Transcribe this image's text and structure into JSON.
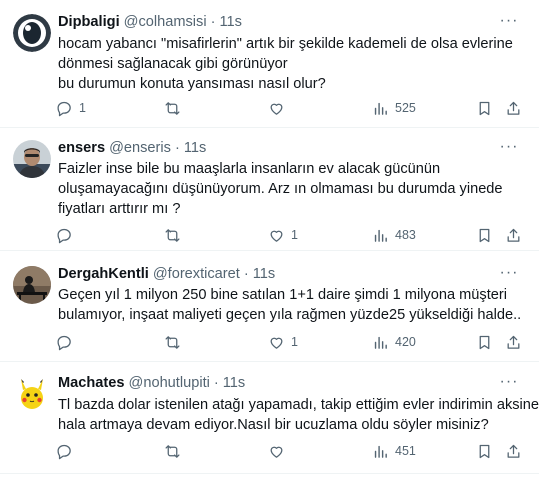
{
  "tweets": [
    {
      "name": "Dipbaligi",
      "handle": "@colhamsisi",
      "time": "11s",
      "lines": [
        "hocam yabancı \"misafirlerin\" artık bir şekilde kademeli de olsa evlerine",
        "dönmesi sağlanacak gibi görünüyor",
        "bu durumun konuta yansıması nasıl olur?"
      ],
      "replies": "1",
      "retweets": "",
      "likes": "",
      "views": "525",
      "avatar": "eye-logo-avatar"
    },
    {
      "name": "ensers",
      "handle": "@enseris",
      "time": "11s",
      "lines": [
        "Faizler inse bile bu maaşlarla insanların ev alacak gücünün",
        "oluşamayacağını düşünüyorum. Arz ın olmaması bu durumda yinede",
        "fiyatları arttırır mı ?"
      ],
      "replies": "",
      "retweets": "",
      "likes": "1",
      "views": "483",
      "avatar": "person-photo-avatar"
    },
    {
      "name": "DergahKentli",
      "handle": "@forexticaret",
      "time": "11s",
      "lines": [
        "Geçen yıl 1 milyon 250 bine satılan 1+1 daire şimdi 1 milyona müşteri",
        "bulamıyor, inşaat maliyeti geçen yıla rağmen yüzde25 yükseldiği halde.."
      ],
      "replies": "",
      "retweets": "",
      "likes": "1",
      "views": "420",
      "avatar": "silhouette-bench-avatar"
    },
    {
      "name": "Machates",
      "handle": "@nohutlupiti",
      "time": "11s",
      "lines": [
        "Tl bazda dolar istenilen atağı yapamadı, takip ettiğim evler indirimin aksine",
        "hala artmaya devam ediyor.Nasıl bir ucuzlama oldu söyler misiniz?"
      ],
      "replies": "",
      "retweets": "",
      "likes": "",
      "views": "451",
      "avatar": "pikachu-avatar"
    }
  ],
  "icons": {
    "reply": "reply-icon",
    "retweet": "retweet-icon",
    "like": "heart-icon",
    "views": "views-chart-icon",
    "bookmark": "bookmark-icon",
    "share": "share-icon",
    "more": "more-dots-icon"
  },
  "colors": {
    "text": "#0f1419",
    "secondary": "#536471",
    "divider": "#eff3f4"
  }
}
